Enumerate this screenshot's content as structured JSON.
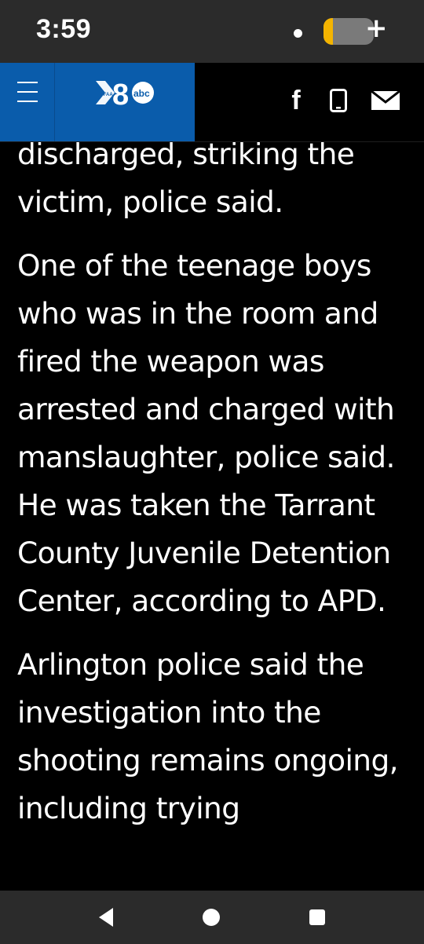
{
  "status_bar": {
    "time": "3:59",
    "battery_level": 0.18,
    "battery_color": "#f4b400",
    "charging": true
  },
  "header": {
    "brand_color": "#0a5cab",
    "logo": {
      "station": "WFAA",
      "channel": "8",
      "network": "abc"
    },
    "menu_icon": "hamburger-icon",
    "social": [
      {
        "name": "facebook-icon",
        "label": "f"
      },
      {
        "name": "phone-icon"
      },
      {
        "name": "email-icon"
      }
    ]
  },
  "article": {
    "paragraphs": [
      "discharged, striking the victim, police said.",
      "One of the teenage boys who was in the room and fired the weapon was arrested and charged with manslaughter, police said. He was taken the Tarrant County Juvenile Detention Center, according to APD.",
      "Arlington police said the investigation into the shooting remains ongoing, including trying"
    ]
  },
  "nav_bar": {
    "buttons": [
      "back-icon",
      "home-icon",
      "recent-apps-icon"
    ]
  }
}
